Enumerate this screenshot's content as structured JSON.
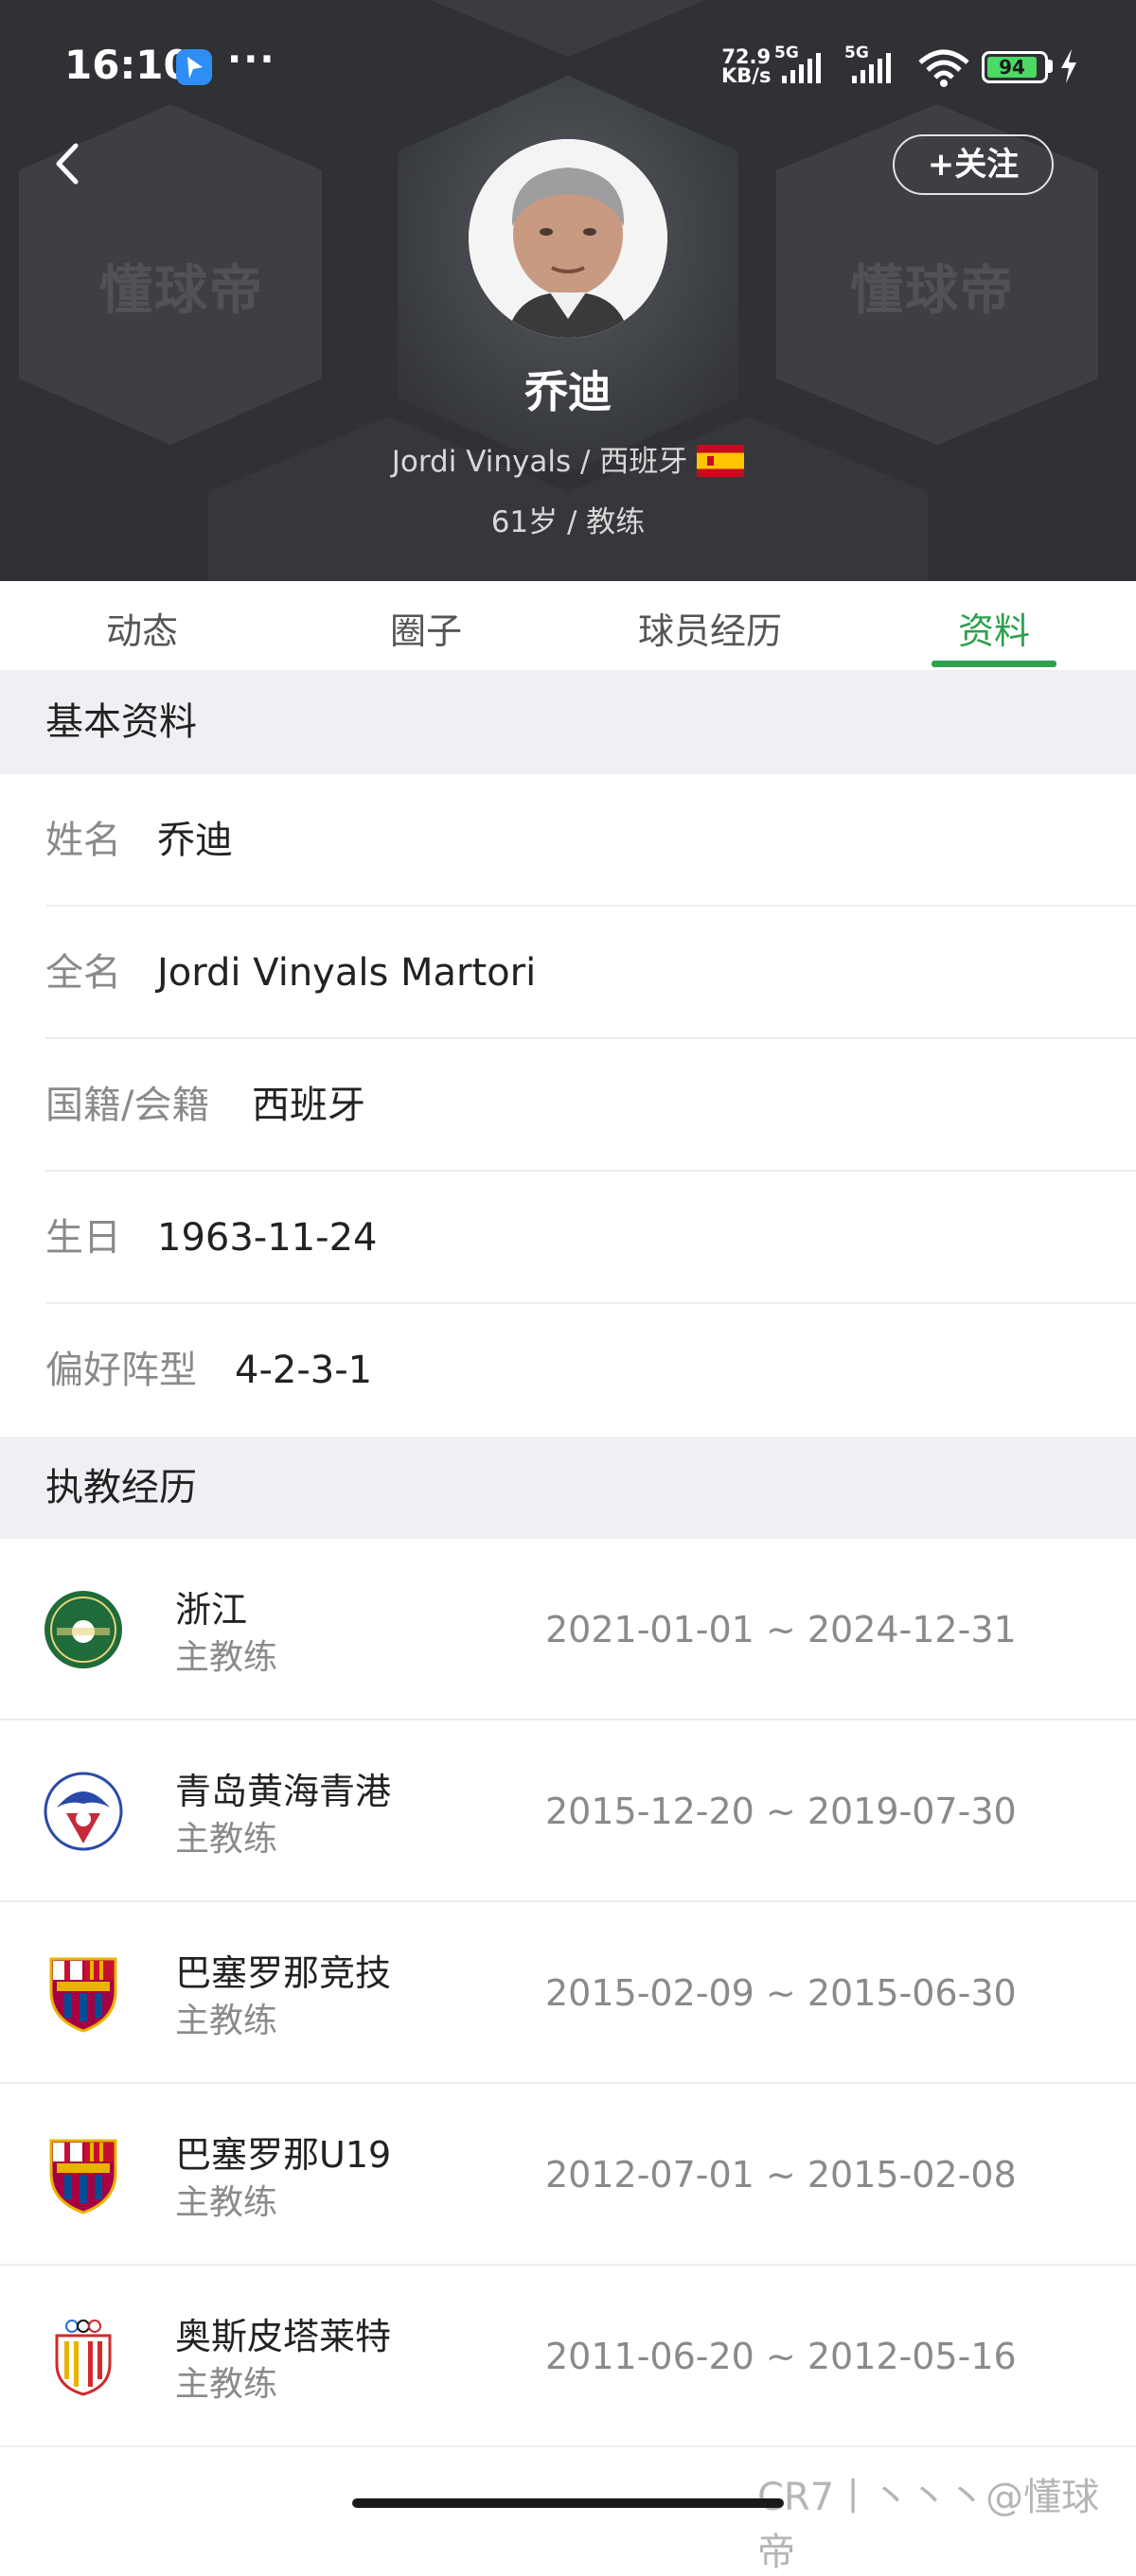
{
  "status_bar": {
    "time": "16:10",
    "more": "···",
    "net_speed_value": "72.9",
    "net_speed_unit": "KB/s",
    "sim1": "5G",
    "sim2": "5G",
    "battery": "94"
  },
  "header": {
    "watermark_left": "懂球帝",
    "watermark_right": "懂球帝",
    "follow_label": "+关注",
    "name": "乔迪",
    "subtitle": "Jordi Vinyals / 西班牙",
    "age_role": "61岁 / 教练"
  },
  "tabs": [
    {
      "label": "动态"
    },
    {
      "label": "圈子"
    },
    {
      "label": "球员经历"
    },
    {
      "label": "资料"
    }
  ],
  "basic_info": {
    "title": "基本资料",
    "rows": [
      {
        "label": "姓名",
        "value": "乔迪"
      },
      {
        "label": "全名",
        "value": "Jordi Vinyals Martori"
      },
      {
        "label": "国籍/会籍",
        "value": "西班牙"
      },
      {
        "label": "生日",
        "value": "1963-11-24"
      },
      {
        "label": "偏好阵型",
        "value": "4-2-3-1"
      }
    ]
  },
  "coaching": {
    "title": "执教经历",
    "items": [
      {
        "club": "浙江",
        "role": "主教练",
        "dates": "2021-01-01 ~ 2024-12-31",
        "logo": "zhejiang-logo"
      },
      {
        "club": "青岛黄海青港",
        "role": "主教练",
        "dates": "2015-12-20 ~ 2019-07-30",
        "logo": "qingdao-logo"
      },
      {
        "club": "巴塞罗那竞技",
        "role": "主教练",
        "dates": "2015-02-09 ~ 2015-06-30",
        "logo": "barcelona-logo"
      },
      {
        "club": "巴塞罗那U19",
        "role": "主教练",
        "dates": "2012-07-01 ~ 2015-02-08",
        "logo": "barcelona-logo"
      },
      {
        "club": "奥斯皮塔莱特",
        "role": "主教练",
        "dates": "2011-06-20 ~ 2012-05-16",
        "logo": "hospitalet-logo"
      }
    ]
  },
  "credit": "CR7丨丶丶丶@懂球帝",
  "colors": {
    "accent": "#2ea14e",
    "header_bg": "#2f3135",
    "section_bg": "#eef0f3"
  }
}
